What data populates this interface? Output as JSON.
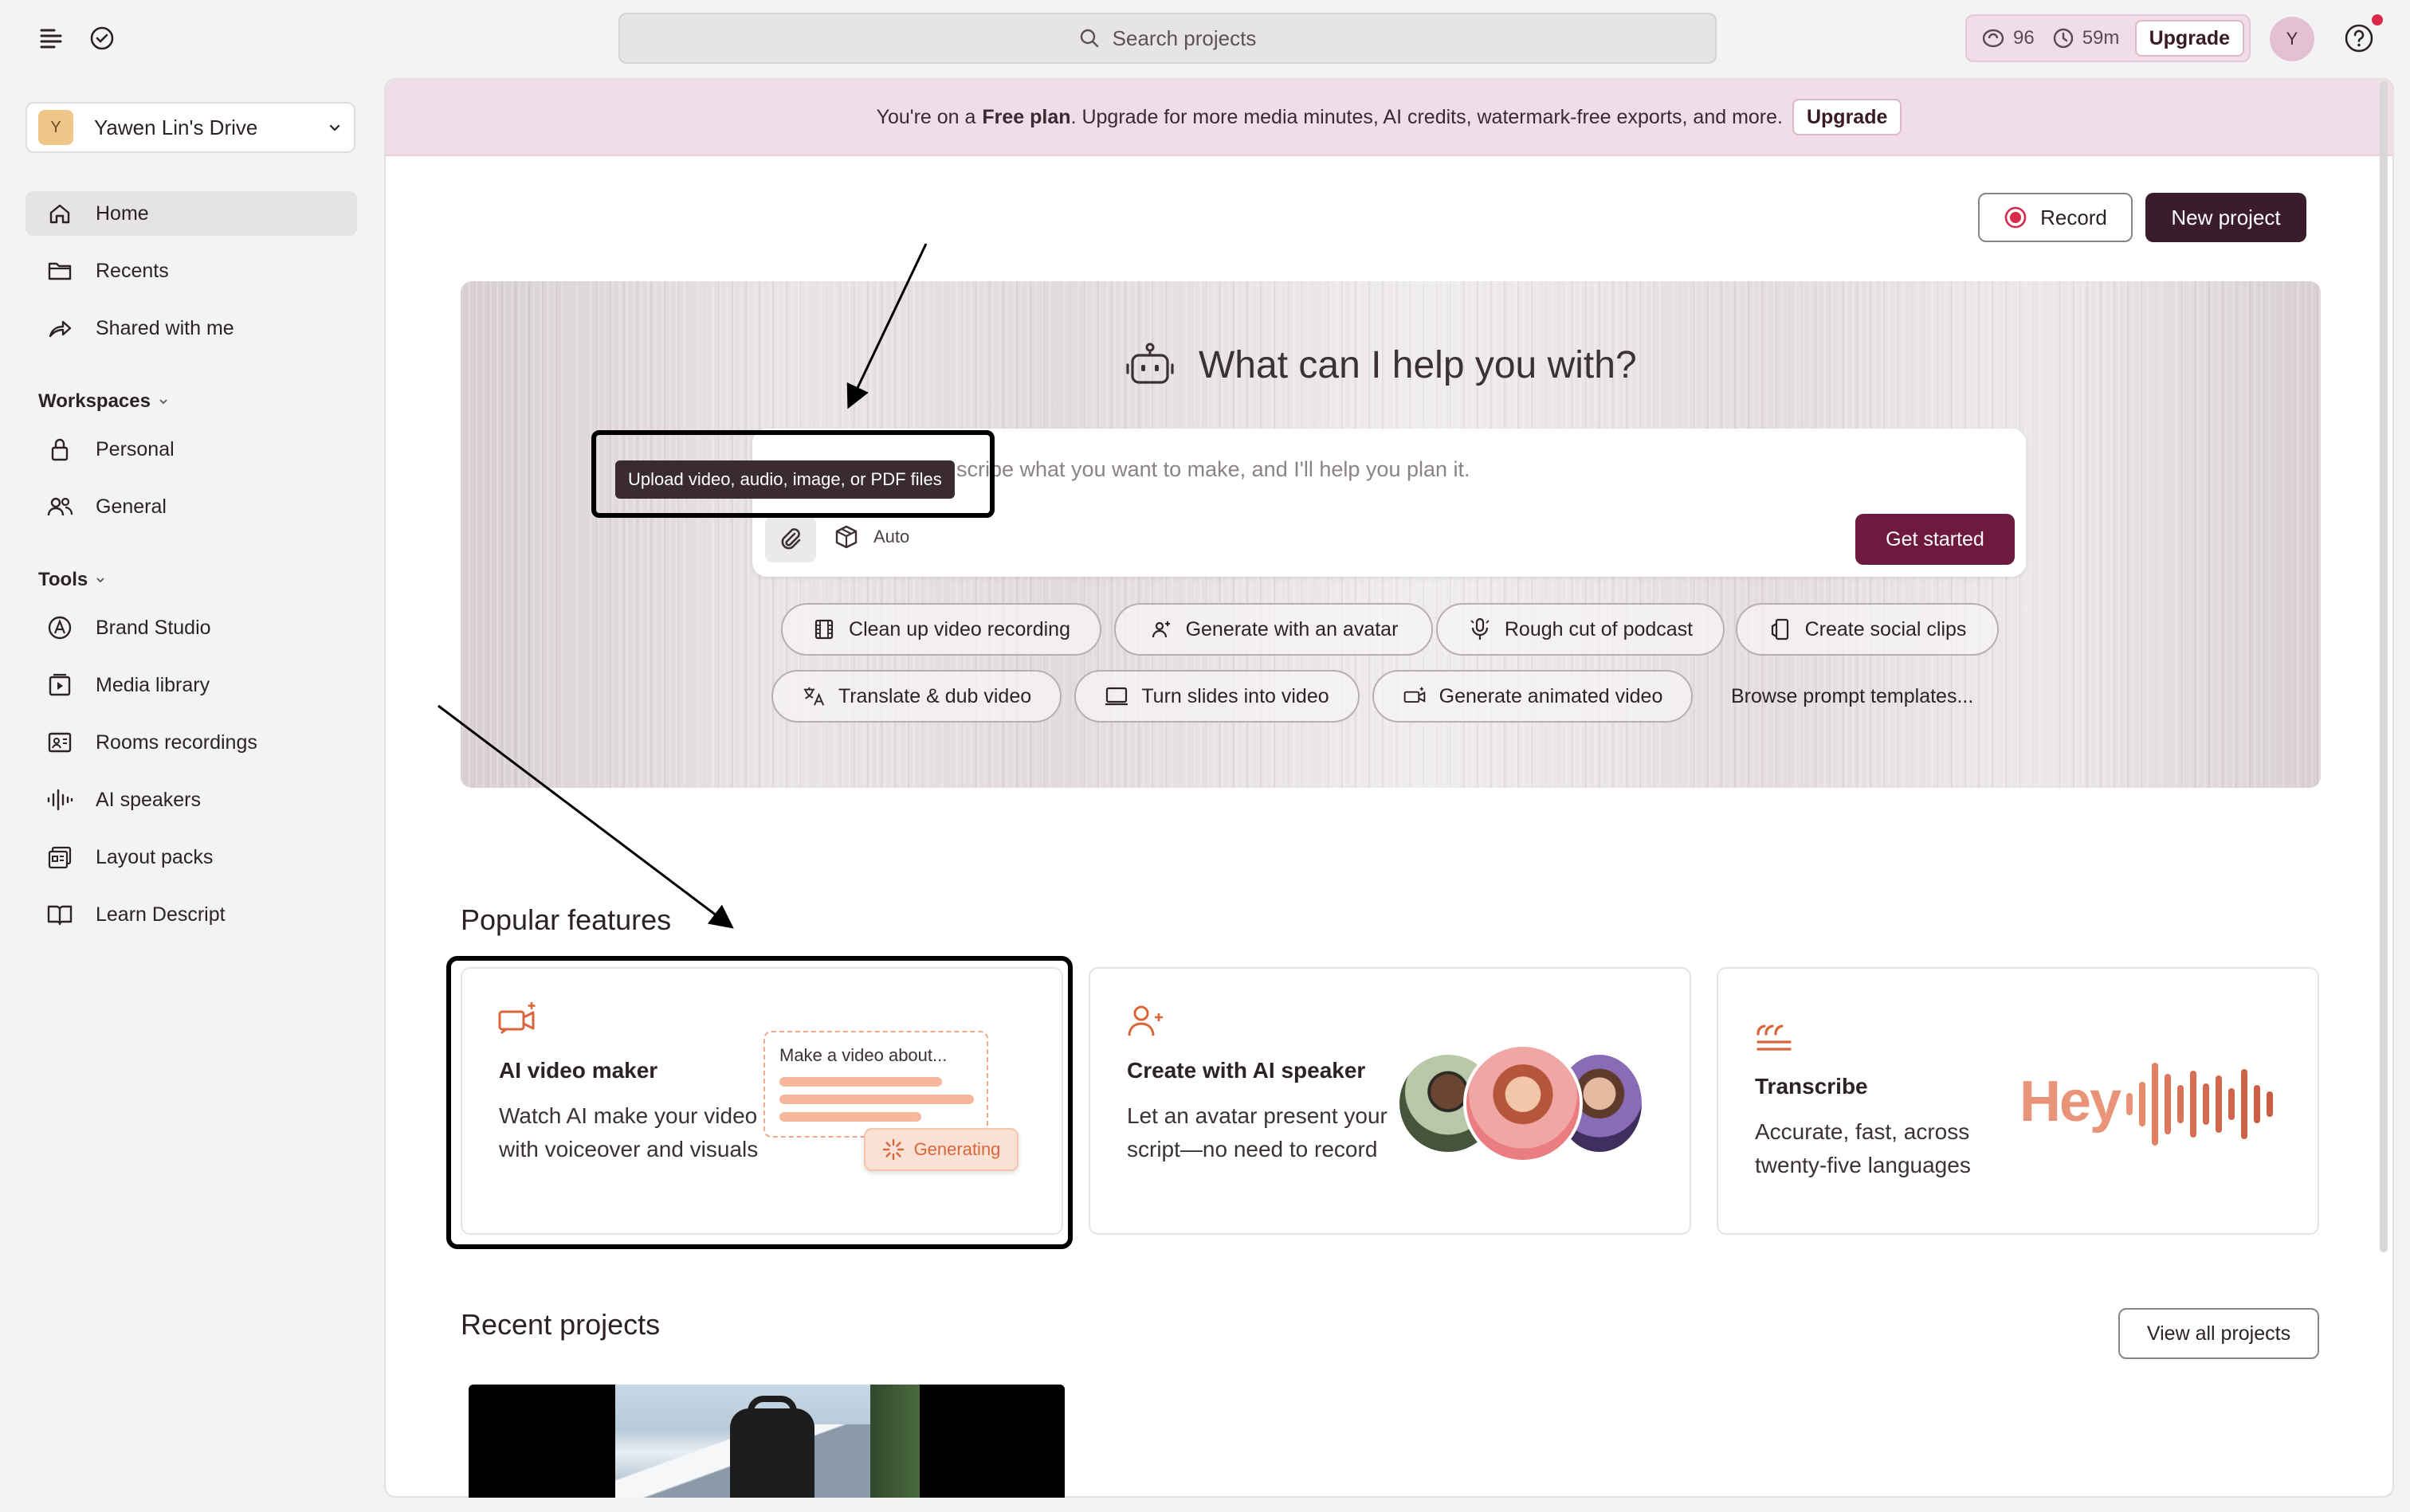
{
  "topbar": {
    "search_placeholder": "Search projects",
    "usage_ai_credits": "96",
    "usage_minutes": "59m",
    "upgrade_label": "Upgrade",
    "avatar_initial": "Y"
  },
  "sidebar": {
    "drive_initial": "Y",
    "drive_name": "Yawen Lin's Drive",
    "nav": [
      {
        "label": "Home",
        "icon": "home-icon"
      },
      {
        "label": "Recents",
        "icon": "folder-icon"
      },
      {
        "label": "Shared with me",
        "icon": "share-icon"
      }
    ],
    "workspaces_heading": "Workspaces",
    "workspaces": [
      {
        "label": "Personal",
        "icon": "lock-icon"
      },
      {
        "label": "General",
        "icon": "people-icon"
      }
    ],
    "tools_heading": "Tools",
    "tools": [
      {
        "label": "Brand Studio",
        "icon": "brand-icon"
      },
      {
        "label": "Media library",
        "icon": "media-library-icon"
      },
      {
        "label": "Rooms recordings",
        "icon": "rooms-icon"
      },
      {
        "label": "AI speakers",
        "icon": "waveform-icon"
      },
      {
        "label": "Layout packs",
        "icon": "layout-icon"
      },
      {
        "label": "Learn Descript",
        "icon": "book-icon"
      }
    ]
  },
  "banner": {
    "prefix": "You're on a",
    "plan": "Free plan",
    "suffix": ". Upgrade for more media minutes, AI credits, watermark-free exports, and more.",
    "upgrade_label": "Upgrade"
  },
  "actions": {
    "record_label": "Record",
    "new_project_label": "New project"
  },
  "hero": {
    "title": "What can I help you with?",
    "prompt_placeholder": "scribe what you want to make, and I'll help you plan it.",
    "tooltip": "Upload video, audio, image, or PDF files",
    "auto_label": "Auto",
    "get_started_label": "Get started",
    "chips": [
      {
        "label": "Clean up video recording",
        "icon": "film-icon"
      },
      {
        "label": "Generate with an avatar",
        "icon": "avatar-sparkle-icon"
      },
      {
        "label": "Rough cut of podcast",
        "icon": "microphone-icon"
      },
      {
        "label": "Create social clips",
        "icon": "phone-clip-icon"
      },
      {
        "label": "Translate & dub video",
        "icon": "translate-icon"
      },
      {
        "label": "Turn slides into video",
        "icon": "slides-icon"
      },
      {
        "label": "Generate animated video",
        "icon": "camera-sparkle-icon"
      }
    ],
    "browse_label": "Browse prompt templates..."
  },
  "popular": {
    "heading": "Popular features",
    "cards": [
      {
        "title": "AI video maker",
        "desc": "Watch AI make your video with voiceover and visuals",
        "mock_text": "Make a video about...",
        "pill": "Generating"
      },
      {
        "title": "Create with AI speaker",
        "desc": "Let an avatar present your script—no need to record"
      },
      {
        "title": "Transcribe",
        "desc": "Accurate, fast, across twenty-five languages",
        "hey": "Hey"
      }
    ]
  },
  "recent": {
    "heading": "Recent projects",
    "view_all_label": "View all projects"
  },
  "colors": {
    "accent": "#6e1a3e",
    "brand_dark": "#3b1c2c",
    "banner_bg": "#f1dde7",
    "orange": "#d8663a"
  }
}
